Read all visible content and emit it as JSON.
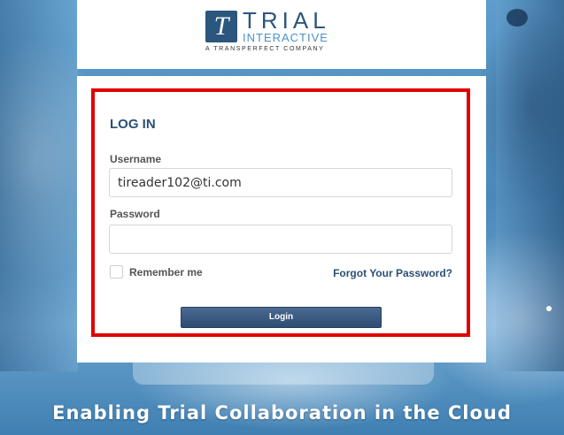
{
  "brand": {
    "logo_mark": "T",
    "name": "TRIAL",
    "name_sub": "INTERACTIVE",
    "tagline_company": "A TRANSPERFECT COMPANY"
  },
  "login": {
    "title": "LOG IN",
    "username_label": "Username",
    "username_value": "tireader102@ti.com",
    "password_label": "Password",
    "password_value": "",
    "remember_label": "Remember me",
    "remember_checked": false,
    "forgot_link": "Forgot Your Password?",
    "submit_label": "Login"
  },
  "footer": {
    "headline": "Enabling Trial Collaboration in the Cloud"
  },
  "colors": {
    "brand_navy": "#2b567d",
    "highlight_border": "#e00000",
    "button": "#2f4c72"
  }
}
